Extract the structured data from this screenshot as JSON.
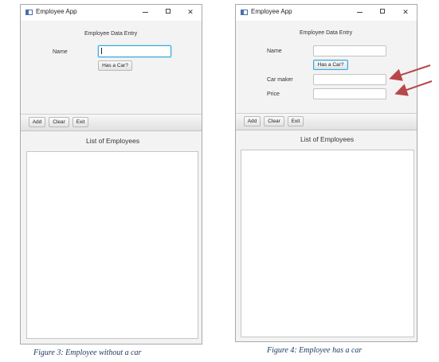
{
  "colors": {
    "accent": "#3fa7d6",
    "arrow": "#b8474a"
  },
  "windows": [
    {
      "title": "Employee App",
      "controls": {
        "close": "✕"
      },
      "heading": "Employee Data Entry",
      "name_label": "Name",
      "name_value": "",
      "has_car_label": "Has a Car?",
      "buttons": {
        "add": "Add",
        "clear": "Clear",
        "exit": "Exit"
      },
      "list_title": "List of Employees"
    },
    {
      "title": "Employee App",
      "controls": {
        "close": "✕"
      },
      "heading": "Employee Data Entry",
      "name_label": "Name",
      "name_value": "",
      "has_car_label": "Has a Car?",
      "car_maker_label": "Car maker",
      "car_maker_value": "",
      "price_label": "Price",
      "price_value": "",
      "buttons": {
        "add": "Add",
        "clear": "Clear",
        "exit": "Exit"
      },
      "list_title": "List of Employees"
    }
  ],
  "captions": [
    "Figure 3: Employee without a car",
    "Figure 4:  Employee has a car"
  ]
}
